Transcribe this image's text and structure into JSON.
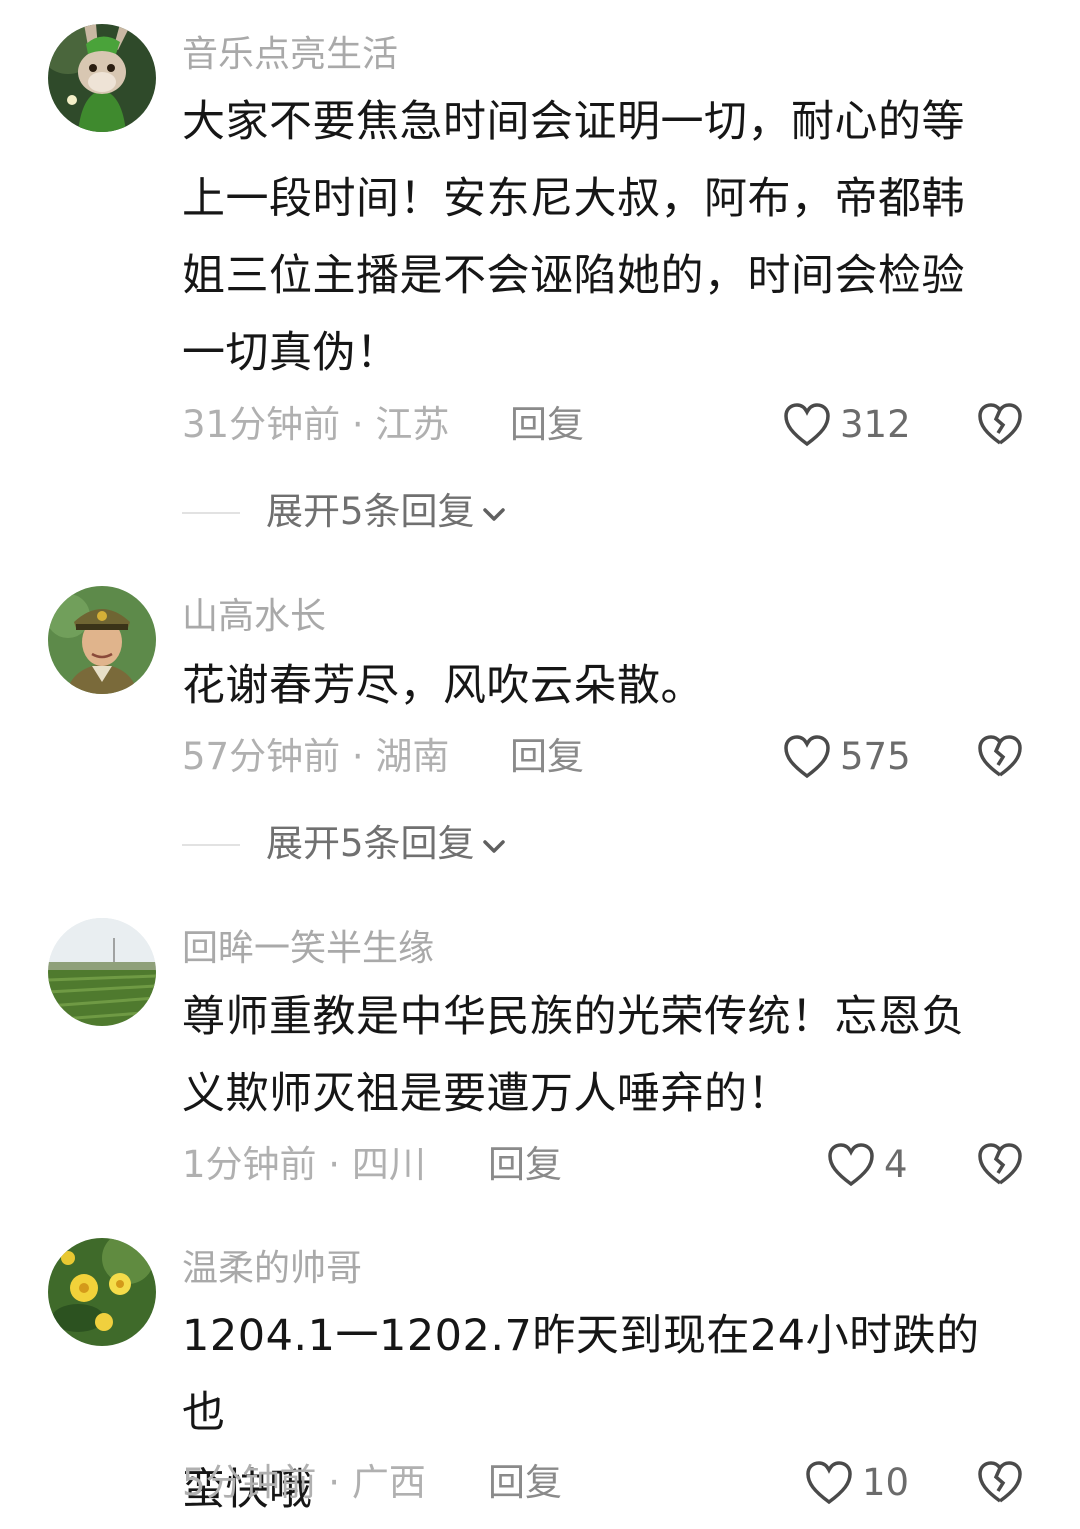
{
  "comments": [
    {
      "username": "音乐点亮生活",
      "lines": [
        "大家不要焦急时间会证明一切，耐心的等",
        "上一段时间！安东尼大叔，阿布，帝都韩",
        "姐三位主播是不会诬陷她的，时间会检验",
        "一切真伪！"
      ],
      "meta": "31分钟前 · 江苏",
      "reply_label": "回复",
      "likes": "312",
      "expand_label": "展开5条回复",
      "avatar_icon": "rabbit-avatar-icon"
    },
    {
      "username": "山高水长",
      "lines": [
        "花谢春芳尽，风吹云朵散。"
      ],
      "meta": "57分钟前 · 湖南",
      "reply_label": "回复",
      "likes": "575",
      "expand_label": "展开5条回复",
      "avatar_icon": "soldier-avatar-icon"
    },
    {
      "username": "回眸一笑半生缘",
      "lines": [
        "尊师重教是中华民族的光荣传统！忘恩负",
        "义欺师灭祖是要遭万人唾弃的！"
      ],
      "meta": "1分钟前 · 四川",
      "reply_label": "回复",
      "likes": "4",
      "avatar_icon": "field-landscape-avatar-icon"
    },
    {
      "username": "温柔的帅哥",
      "lines": [
        "1204.1一1202.7昨天到现在24小时跌的也",
        "蛮快哦"
      ],
      "meta": "5分钟前 · 广西",
      "reply_label": "回复",
      "likes": "10",
      "avatar_icon": "yellow-flowers-avatar-icon"
    }
  ],
  "colors": {
    "username": "#a9a9a9",
    "content": "#161616",
    "meta": "#b0b0b0",
    "background": "#ffffff"
  }
}
